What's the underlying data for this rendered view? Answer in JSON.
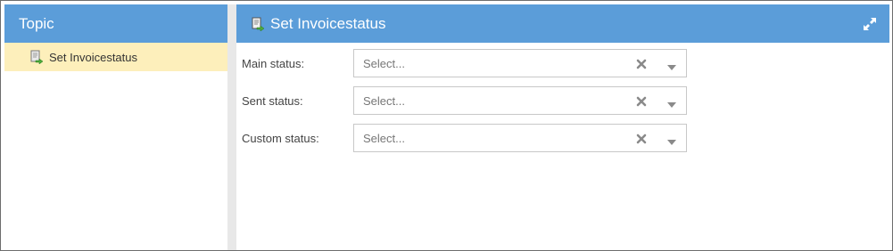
{
  "left_panel": {
    "title": "Topic",
    "items": [
      {
        "label": "Set Invoicestatus",
        "icon": "document-arrow-icon",
        "selected": true
      }
    ]
  },
  "right_panel": {
    "title": "Set Invoicestatus",
    "title_icon": "document-arrow-icon",
    "expand_icon": "expand-icon",
    "fields": [
      {
        "label": "Main status:",
        "value": "",
        "placeholder": "Select..."
      },
      {
        "label": "Sent status:",
        "value": "",
        "placeholder": "Select..."
      },
      {
        "label": "Custom status:",
        "value": "",
        "placeholder": "Select..."
      }
    ]
  },
  "colors": {
    "header_blue": "#5b9dd9",
    "selected_item": "#fdefbb",
    "gutter": "#e8e8e8"
  }
}
